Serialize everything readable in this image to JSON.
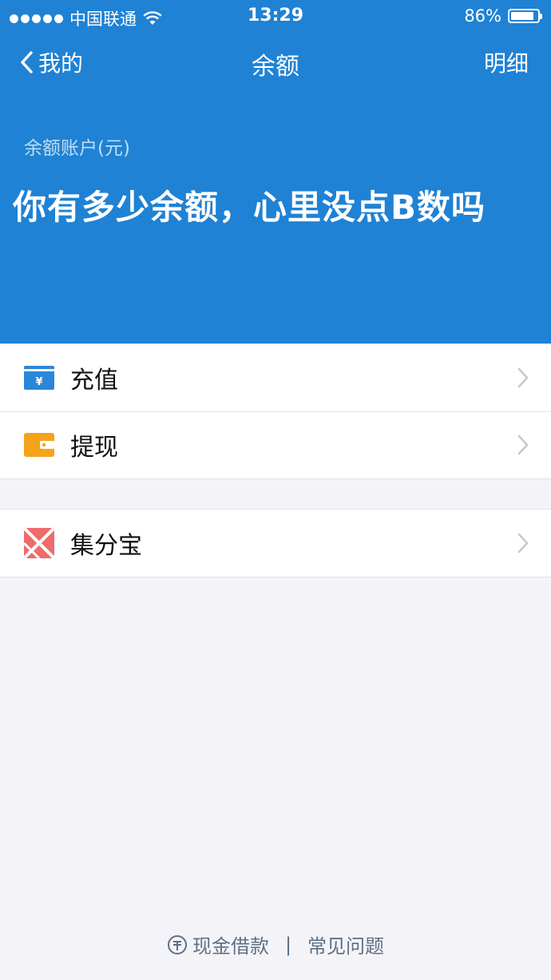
{
  "status_bar": {
    "carrier": "中国联通",
    "time": "13:29",
    "battery_percent_text": "86%",
    "battery_level": 0.86
  },
  "nav": {
    "back_label": "我的",
    "title": "余额",
    "right_label": "明细"
  },
  "balance": {
    "label": "余额账户(元)",
    "value": "你有多少余额，心里没点B数吗"
  },
  "menu_group_1": [
    {
      "label": "充值",
      "icon": "recharge-icon",
      "icon_color": "#2a86d8"
    },
    {
      "label": "提现",
      "icon": "withdraw-wallet-icon",
      "icon_color": "#f5a31a"
    }
  ],
  "menu_group_2": [
    {
      "label": "集分宝",
      "icon": "jifenbao-icon",
      "icon_color": "#ef6a6a"
    }
  ],
  "footer": {
    "link_1": "现金借款",
    "separator": "|",
    "link_2": "常见问题"
  },
  "colors": {
    "header_blue": "#1f82d4",
    "background": "#f4f4f8",
    "footer_text": "#5f6f86"
  }
}
